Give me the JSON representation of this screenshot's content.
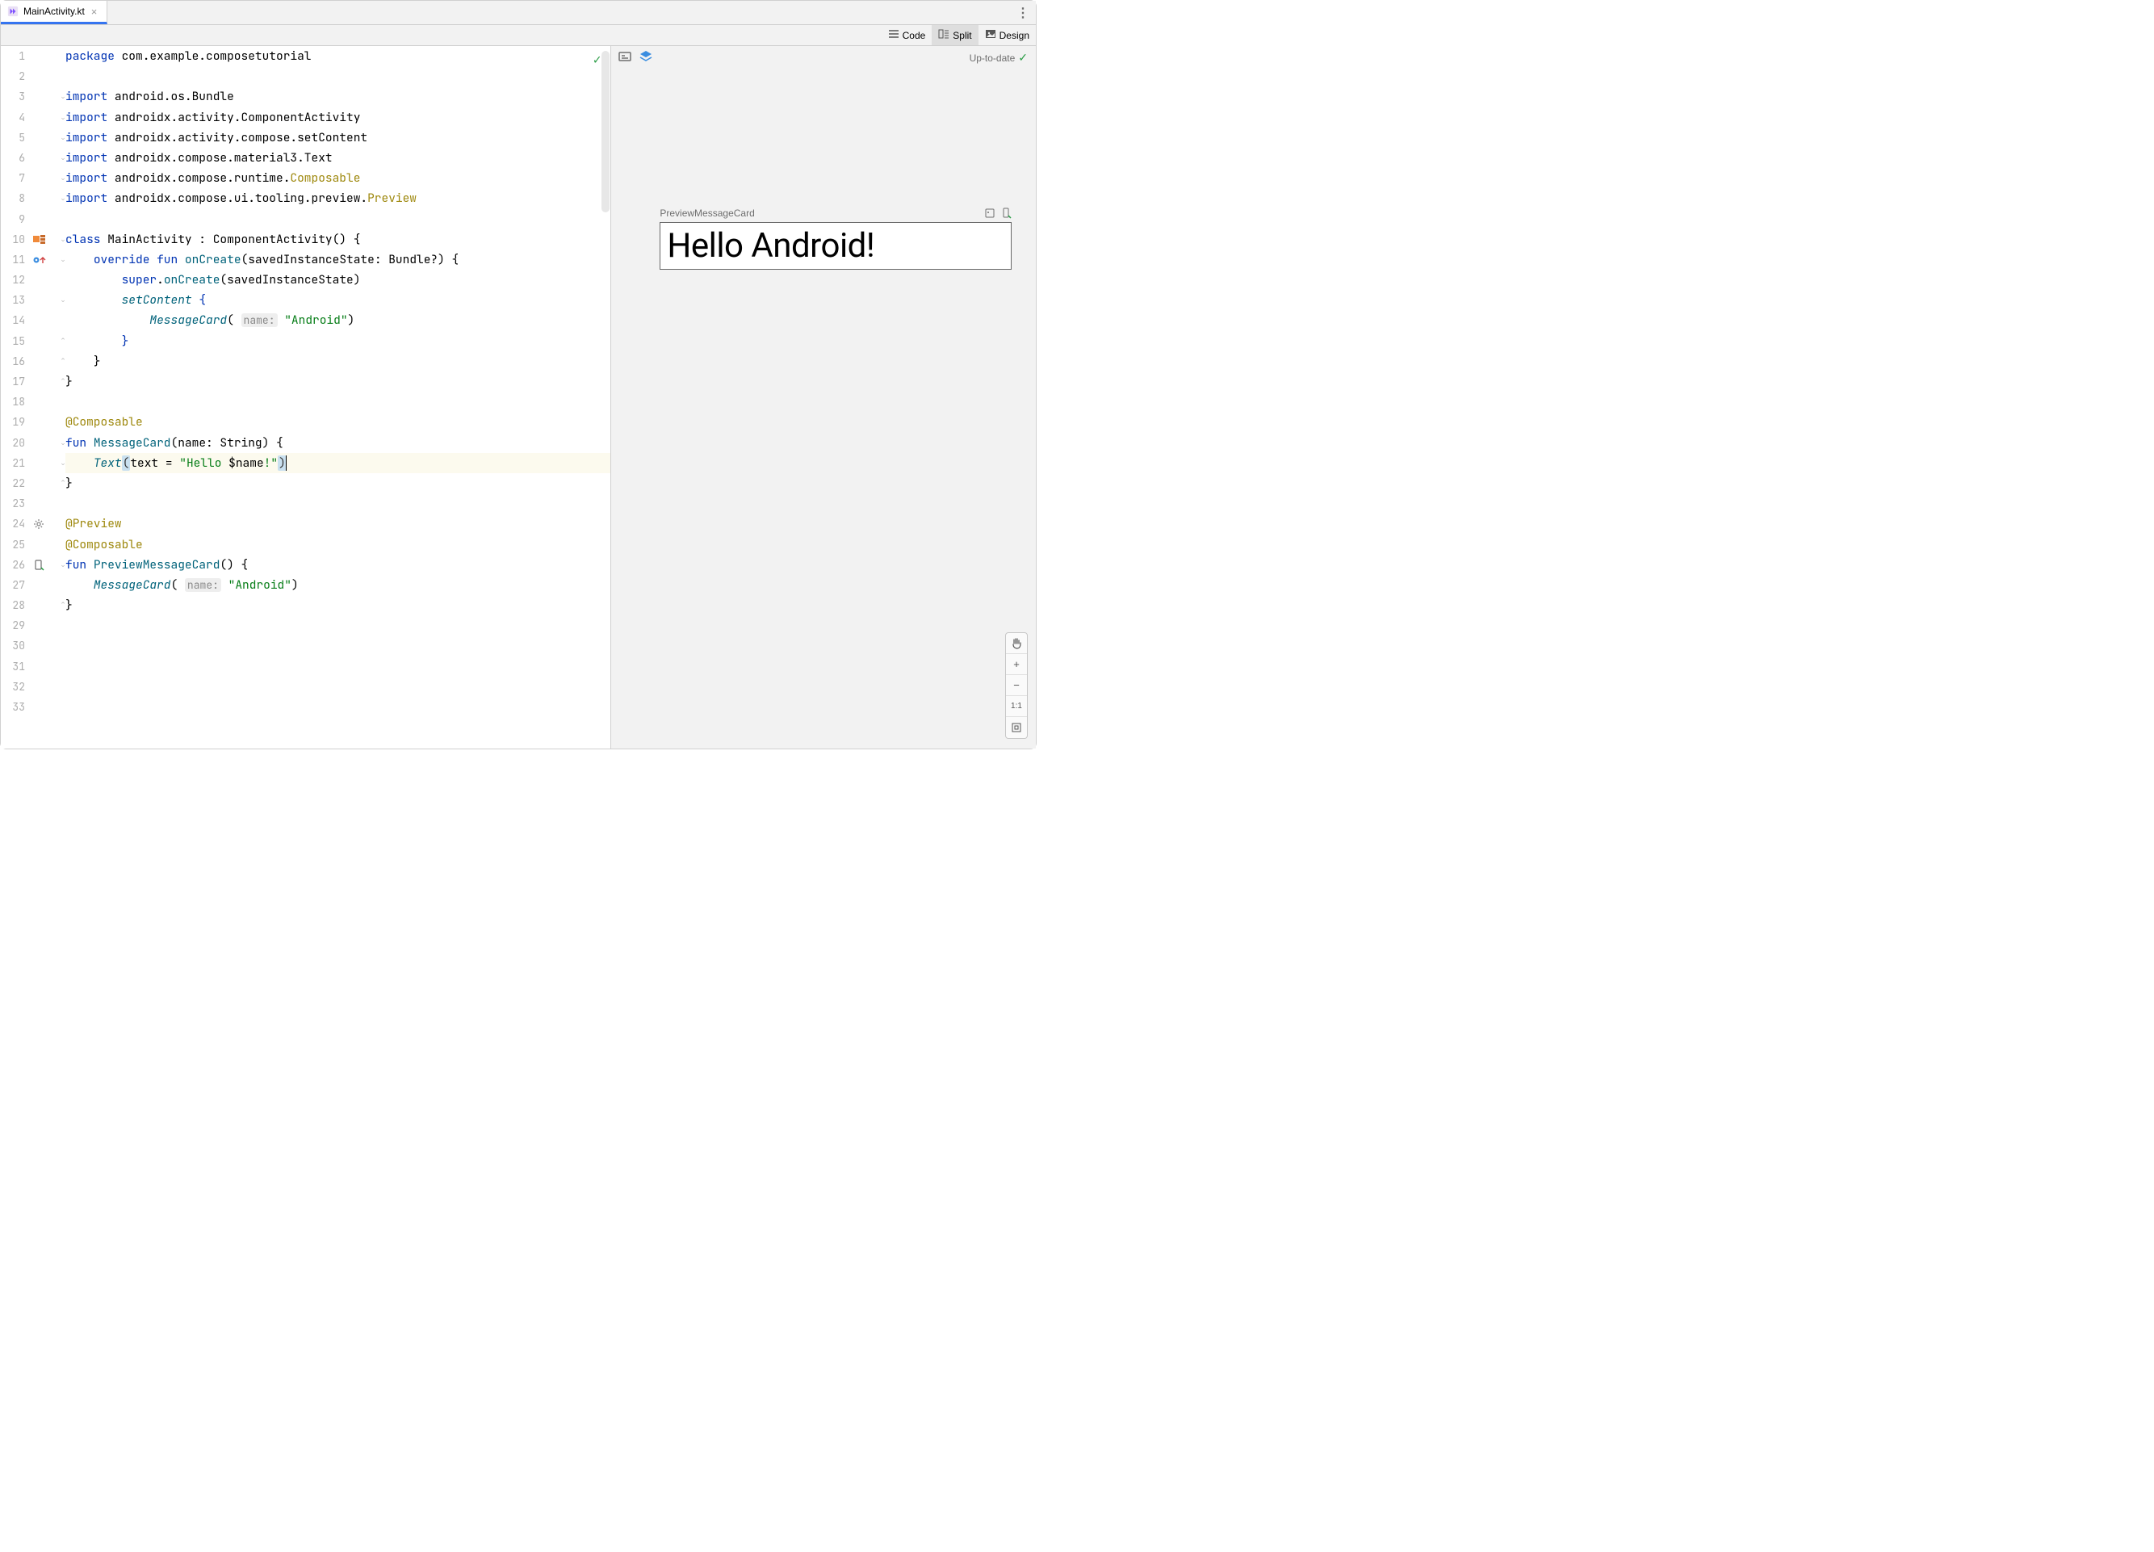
{
  "tab": {
    "filename": "MainActivity.kt"
  },
  "viewmodes": {
    "code": "Code",
    "split": "Split",
    "design": "Design",
    "active": "Split"
  },
  "editor": {
    "total_lines": 33,
    "highlighted_line": 21,
    "inspection_status": "ok",
    "gutter_markers": {
      "10": "class-run",
      "11": "override-up",
      "24": "gear",
      "26": "preview-device"
    },
    "tokens": [
      [
        [
          "kw",
          "package"
        ],
        [
          "pkg",
          " com.example.composetutorial"
        ]
      ],
      [],
      [
        [
          "kw",
          "import"
        ],
        [
          "pkg",
          " android.os.Bundle"
        ]
      ],
      [
        [
          "kw",
          "import"
        ],
        [
          "pkg",
          " androidx.activity.ComponentActivity"
        ]
      ],
      [
        [
          "kw",
          "import"
        ],
        [
          "pkg",
          " androidx.activity.compose.setContent"
        ]
      ],
      [
        [
          "kw",
          "import"
        ],
        [
          "pkg",
          " androidx.compose.material3.Text"
        ]
      ],
      [
        [
          "kw",
          "import"
        ],
        [
          "pkg",
          " androidx.compose.runtime."
        ],
        [
          "annref",
          "Composable"
        ]
      ],
      [
        [
          "kw",
          "import"
        ],
        [
          "pkg",
          " androidx.compose.ui.tooling.preview."
        ],
        [
          "annref",
          "Preview"
        ]
      ],
      [],
      [
        [
          "kw",
          "class"
        ],
        [
          "op",
          " "
        ],
        [
          "pkg",
          "MainActivity"
        ],
        [
          "op",
          " : ComponentActivity() {"
        ]
      ],
      [
        [
          "op",
          "    "
        ],
        [
          "kw",
          "override fun"
        ],
        [
          "op",
          " "
        ],
        [
          "fn",
          "onCreate"
        ],
        [
          "op",
          "(savedInstanceState: Bundle?) {"
        ]
      ],
      [
        [
          "op",
          "        "
        ],
        [
          "kw",
          "super"
        ],
        [
          "op",
          "."
        ],
        [
          "fn",
          "onCreate"
        ],
        [
          "op",
          "(savedInstanceState)"
        ]
      ],
      [
        [
          "op",
          "        "
        ],
        [
          "fnI",
          "setContent"
        ],
        [
          "op",
          " "
        ],
        [
          "kw",
          "{"
        ]
      ],
      [
        [
          "op",
          "            "
        ],
        [
          "fnI",
          "MessageCard"
        ],
        [
          "op",
          "( "
        ],
        [
          "hint",
          "name:"
        ],
        [
          "op",
          " "
        ],
        [
          "str",
          "\"Android\""
        ],
        [
          "op",
          ")"
        ]
      ],
      [
        [
          "op",
          "        "
        ],
        [
          "kw",
          "}"
        ]
      ],
      [
        [
          "op",
          "    }"
        ]
      ],
      [
        [
          "op",
          "}"
        ]
      ],
      [],
      [
        [
          "ann",
          "@Composable"
        ]
      ],
      [
        [
          "kw",
          "fun"
        ],
        [
          "op",
          " "
        ],
        [
          "fn",
          "MessageCard"
        ],
        [
          "op",
          "(name: String) {"
        ]
      ],
      [
        [
          "op",
          "    "
        ],
        [
          "fnI",
          "Text"
        ],
        [
          "brko",
          "("
        ],
        [
          "tvar",
          "text"
        ],
        [
          "op",
          " = "
        ],
        [
          "str",
          "\"Hello "
        ],
        [
          "tvar",
          "$name"
        ],
        [
          "str",
          "!\""
        ],
        [
          "brkc",
          ")"
        ],
        [
          "caret",
          ""
        ]
      ],
      [
        [
          "op",
          "}"
        ]
      ],
      [],
      [
        [
          "ann",
          "@Preview"
        ]
      ],
      [
        [
          "ann",
          "@Composable"
        ]
      ],
      [
        [
          "kw",
          "fun"
        ],
        [
          "op",
          " "
        ],
        [
          "fn",
          "PreviewMessageCard"
        ],
        [
          "op",
          "() {"
        ]
      ],
      [
        [
          "op",
          "    "
        ],
        [
          "fnI",
          "MessageCard"
        ],
        [
          "op",
          "( "
        ],
        [
          "hint",
          "name:"
        ],
        [
          "op",
          " "
        ],
        [
          "str",
          "\"Android\""
        ],
        [
          "op",
          ")"
        ]
      ],
      [
        [
          "op",
          "}"
        ]
      ]
    ]
  },
  "preview": {
    "status": "Up-to-date",
    "composable_name": "PreviewMessageCard",
    "rendered_text": "Hello Android!"
  },
  "zoom": {
    "reset_label": "1:1"
  }
}
